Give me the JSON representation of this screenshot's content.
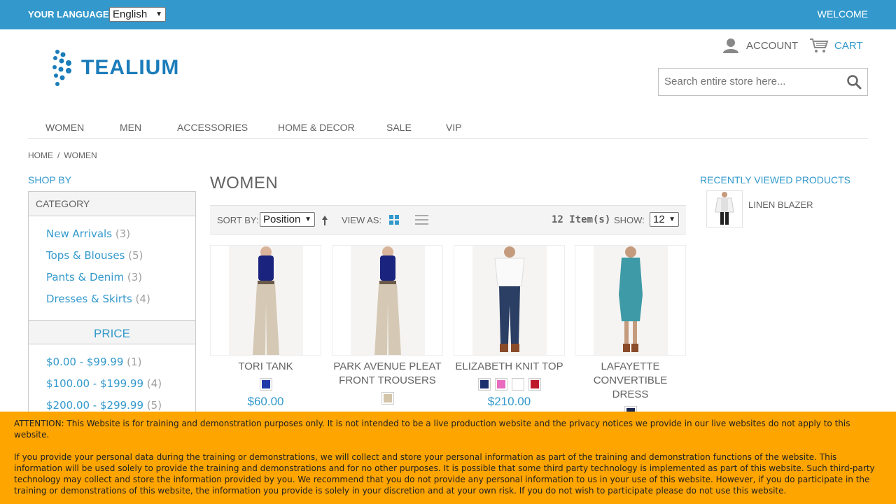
{
  "topbar": {
    "language_label": "YOUR LANGUAGE:",
    "language_value": "English",
    "welcome": "WELCOME",
    "background": "#3399cc"
  },
  "header": {
    "logo_text": "TEALIUM",
    "account": "ACCOUNT",
    "cart": "CART",
    "search_placeholder": "Search entire store here..."
  },
  "nav": {
    "items": [
      "WOMEN",
      "MEN",
      "ACCESSORIES",
      "HOME & DECOR",
      "SALE",
      "VIP"
    ]
  },
  "breadcrumb": {
    "home": "HOME",
    "separator": "/",
    "current": "WOMEN"
  },
  "sidebar": {
    "title": "SHOP BY",
    "category_heading": "CATEGORY",
    "categories": [
      {
        "label": "New Arrivals",
        "count": "(3)"
      },
      {
        "label": "Tops & Blouses",
        "count": "(5)"
      },
      {
        "label": "Pants & Denim",
        "count": "(3)"
      },
      {
        "label": "Dresses & Skirts",
        "count": "(4)"
      }
    ],
    "price_heading": "PRICE",
    "prices": [
      {
        "label": "$0.00 - $99.99",
        "count": "(1)"
      },
      {
        "label": "$100.00 - $199.99",
        "count": "(4)"
      },
      {
        "label": "$200.00 - $299.99",
        "count": "(5)"
      }
    ]
  },
  "main": {
    "title": "WOMEN",
    "toolbar": {
      "sort_label": "SORT BY:",
      "sort_value": "Position",
      "view_label": "VIEW AS:",
      "item_count": "12 Item(s)",
      "show_label": "SHOW:",
      "show_value": "12"
    },
    "products": [
      {
        "name": "TORI TANK",
        "swatches": [
          "#1f3aa8"
        ],
        "price": "$60.00"
      },
      {
        "name": "PARK AVENUE PLEAT FRONT TROUSERS",
        "swatches": [
          "#d4c5a8"
        ],
        "price": ""
      },
      {
        "name": "ELIZABETH KNIT TOP",
        "swatches": [
          "#1b2f6e",
          "#e86bc0",
          "#ffffff",
          "#c0182b"
        ],
        "price": "$210.00"
      },
      {
        "name": "LAFAYETTE CONVERTIBLE DRESS",
        "swatches": [
          "#1b2550"
        ],
        "price": ""
      }
    ]
  },
  "recently_viewed": {
    "title": "RECENTLY VIEWED PRODUCTS",
    "items": [
      {
        "name": "LINEN BLAZER"
      }
    ]
  },
  "notice": {
    "paragraph1": "ATTENTION: This Website is for training and demonstration purposes only. It is not intended to be a live production website and the privacy notices we provide in our live websites do not apply to this website.",
    "paragraph2": "If you provide your personal data during the training or demonstrations, we will collect and store your personal information as part of the training and demonstration functions of the website. This information will be used solely to provide the training and demonstrations and for no other purposes. It is possible that some third party technology is implemented as part of this website. Such third-party technology may collect and store the information provided by you. We recommend that you do not provide any personal information to us in your use of this website. However, if you do participate in the training or demonstrations of this website, the information you provide is solely in your discretion and at your own risk. If you do not wish to participate please do not use this website.",
    "background": "#ffa500"
  }
}
